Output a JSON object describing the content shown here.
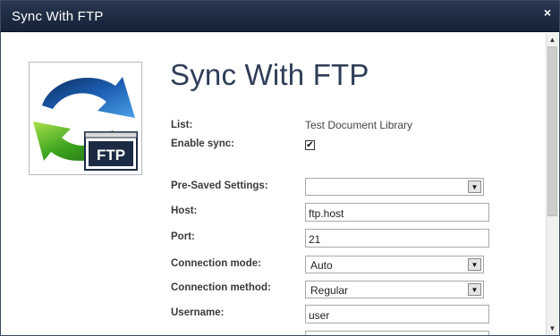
{
  "window": {
    "title": "Sync With FTP",
    "close_glyph": "×"
  },
  "page": {
    "heading": "Sync With FTP"
  },
  "logo": {
    "icon": "ftp-sync-logo",
    "text": "FTP"
  },
  "fields": {
    "list": {
      "label": "List:",
      "value": "Test Document Library"
    },
    "enable_sync": {
      "label": "Enable sync:",
      "checked": true,
      "check_glyph": "✔"
    },
    "presaved": {
      "label": "Pre-Saved Settings:",
      "value": ""
    },
    "host": {
      "label": "Host:",
      "value": "ftp.host"
    },
    "port": {
      "label": "Port:",
      "value": "21"
    },
    "connection_mode": {
      "label": "Connection mode:",
      "value": "Auto"
    },
    "connection_method": {
      "label": "Connection method:",
      "value": "Regular"
    },
    "username": {
      "label": "Username:",
      "value": "user"
    }
  },
  "scrollbar": {
    "up_glyph": "▲",
    "down_glyph": "▼"
  },
  "select_arrow_glyph": "▼"
}
